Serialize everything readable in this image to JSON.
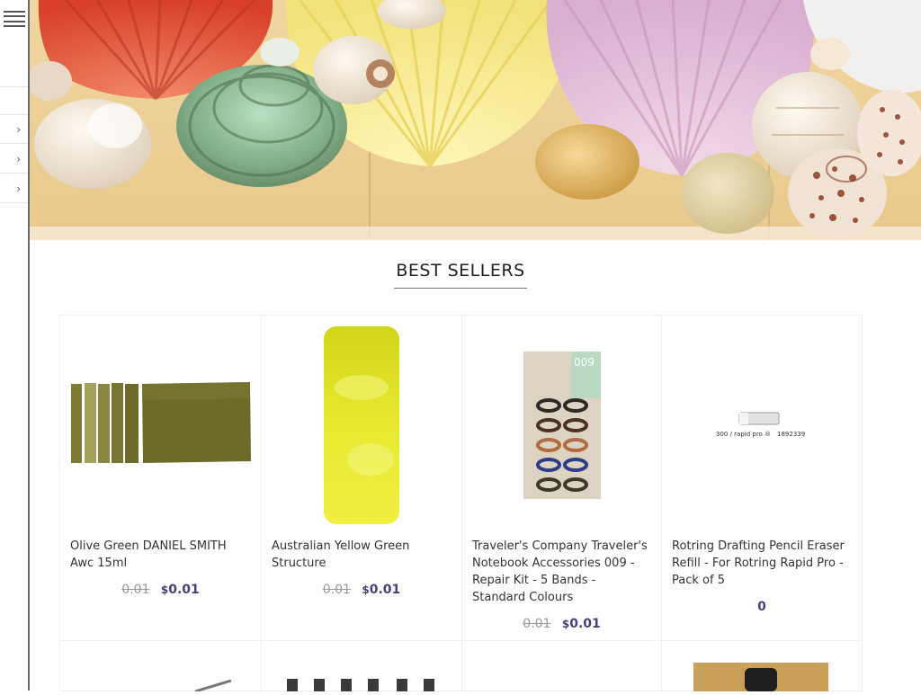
{
  "sidebar": {
    "arrows": [
      "›",
      "›",
      "›"
    ]
  },
  "section": {
    "title": "BEST SELLERS"
  },
  "products": [
    {
      "name": "Olive Green DANIEL SMITH Awc 15ml",
      "old_price": "0.01",
      "currency": "$",
      "price": "0.01"
    },
    {
      "name": "Australian Yellow Green Structure",
      "old_price": "0.01",
      "currency": "$",
      "price": "0.01"
    },
    {
      "name": "Traveler's Company Traveler's Notebook Accessories 009 - Repair Kit - 5 Bands - Standard Colours",
      "old_price": "0.01",
      "currency": "$",
      "price": "0.01"
    },
    {
      "name": "Rotring Drafting Pencil Eraser Refill - For Rotring Rapid Pro - Pack of 5",
      "old_price": "",
      "currency": "",
      "price": "0"
    }
  ],
  "product_image_text": {
    "travel_kit_number": "009",
    "eraser_label": "300 / rapid pro ®",
    "eraser_code": "1892339"
  },
  "colors": {
    "accent_price": "#4a3f7c",
    "olive": "#6e6a2a",
    "yellow_green": "#dde21a"
  }
}
